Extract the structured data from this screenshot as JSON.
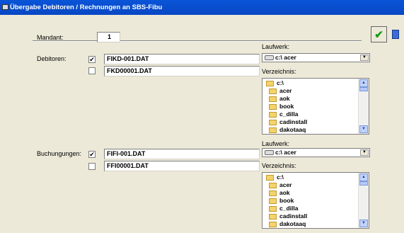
{
  "window": {
    "title": "Übergabe Debitoren / Rechnungen an SBS-Fibu"
  },
  "mandant": {
    "label": "Mandant:",
    "value": "1"
  },
  "debitoren": {
    "label": "Debitoren:",
    "row1": {
      "checked": "✔",
      "file": "FIKD-001.DAT"
    },
    "row2": {
      "checked": "",
      "file": "FKD00001.DAT"
    },
    "laufwerk_label": "Laufwerk:",
    "drive": "c:\\ acer",
    "verzeichnis_label": "Verzeichnis:",
    "dirs": [
      "c:\\",
      "acer",
      "aok",
      "book",
      "c_dilla",
      "cadinstall",
      "dakotaaq"
    ]
  },
  "buchungen": {
    "label": "Buchungungen:",
    "row1": {
      "checked": "✔",
      "file": "FIFI-001.DAT"
    },
    "row2": {
      "checked": "",
      "file": "FFI00001.DAT"
    },
    "laufwerk_label": "Laufwerk:",
    "drive": "c:\\ acer",
    "verzeichnis_label": "Verzeichnis:",
    "dirs": [
      "c:\\",
      "acer",
      "aok",
      "book",
      "c_dilla",
      "cadinstall",
      "dakotaaq"
    ]
  },
  "icons": {
    "ok": "checkmark-icon",
    "exit": "exit-door-icon",
    "window": "window-icon"
  }
}
